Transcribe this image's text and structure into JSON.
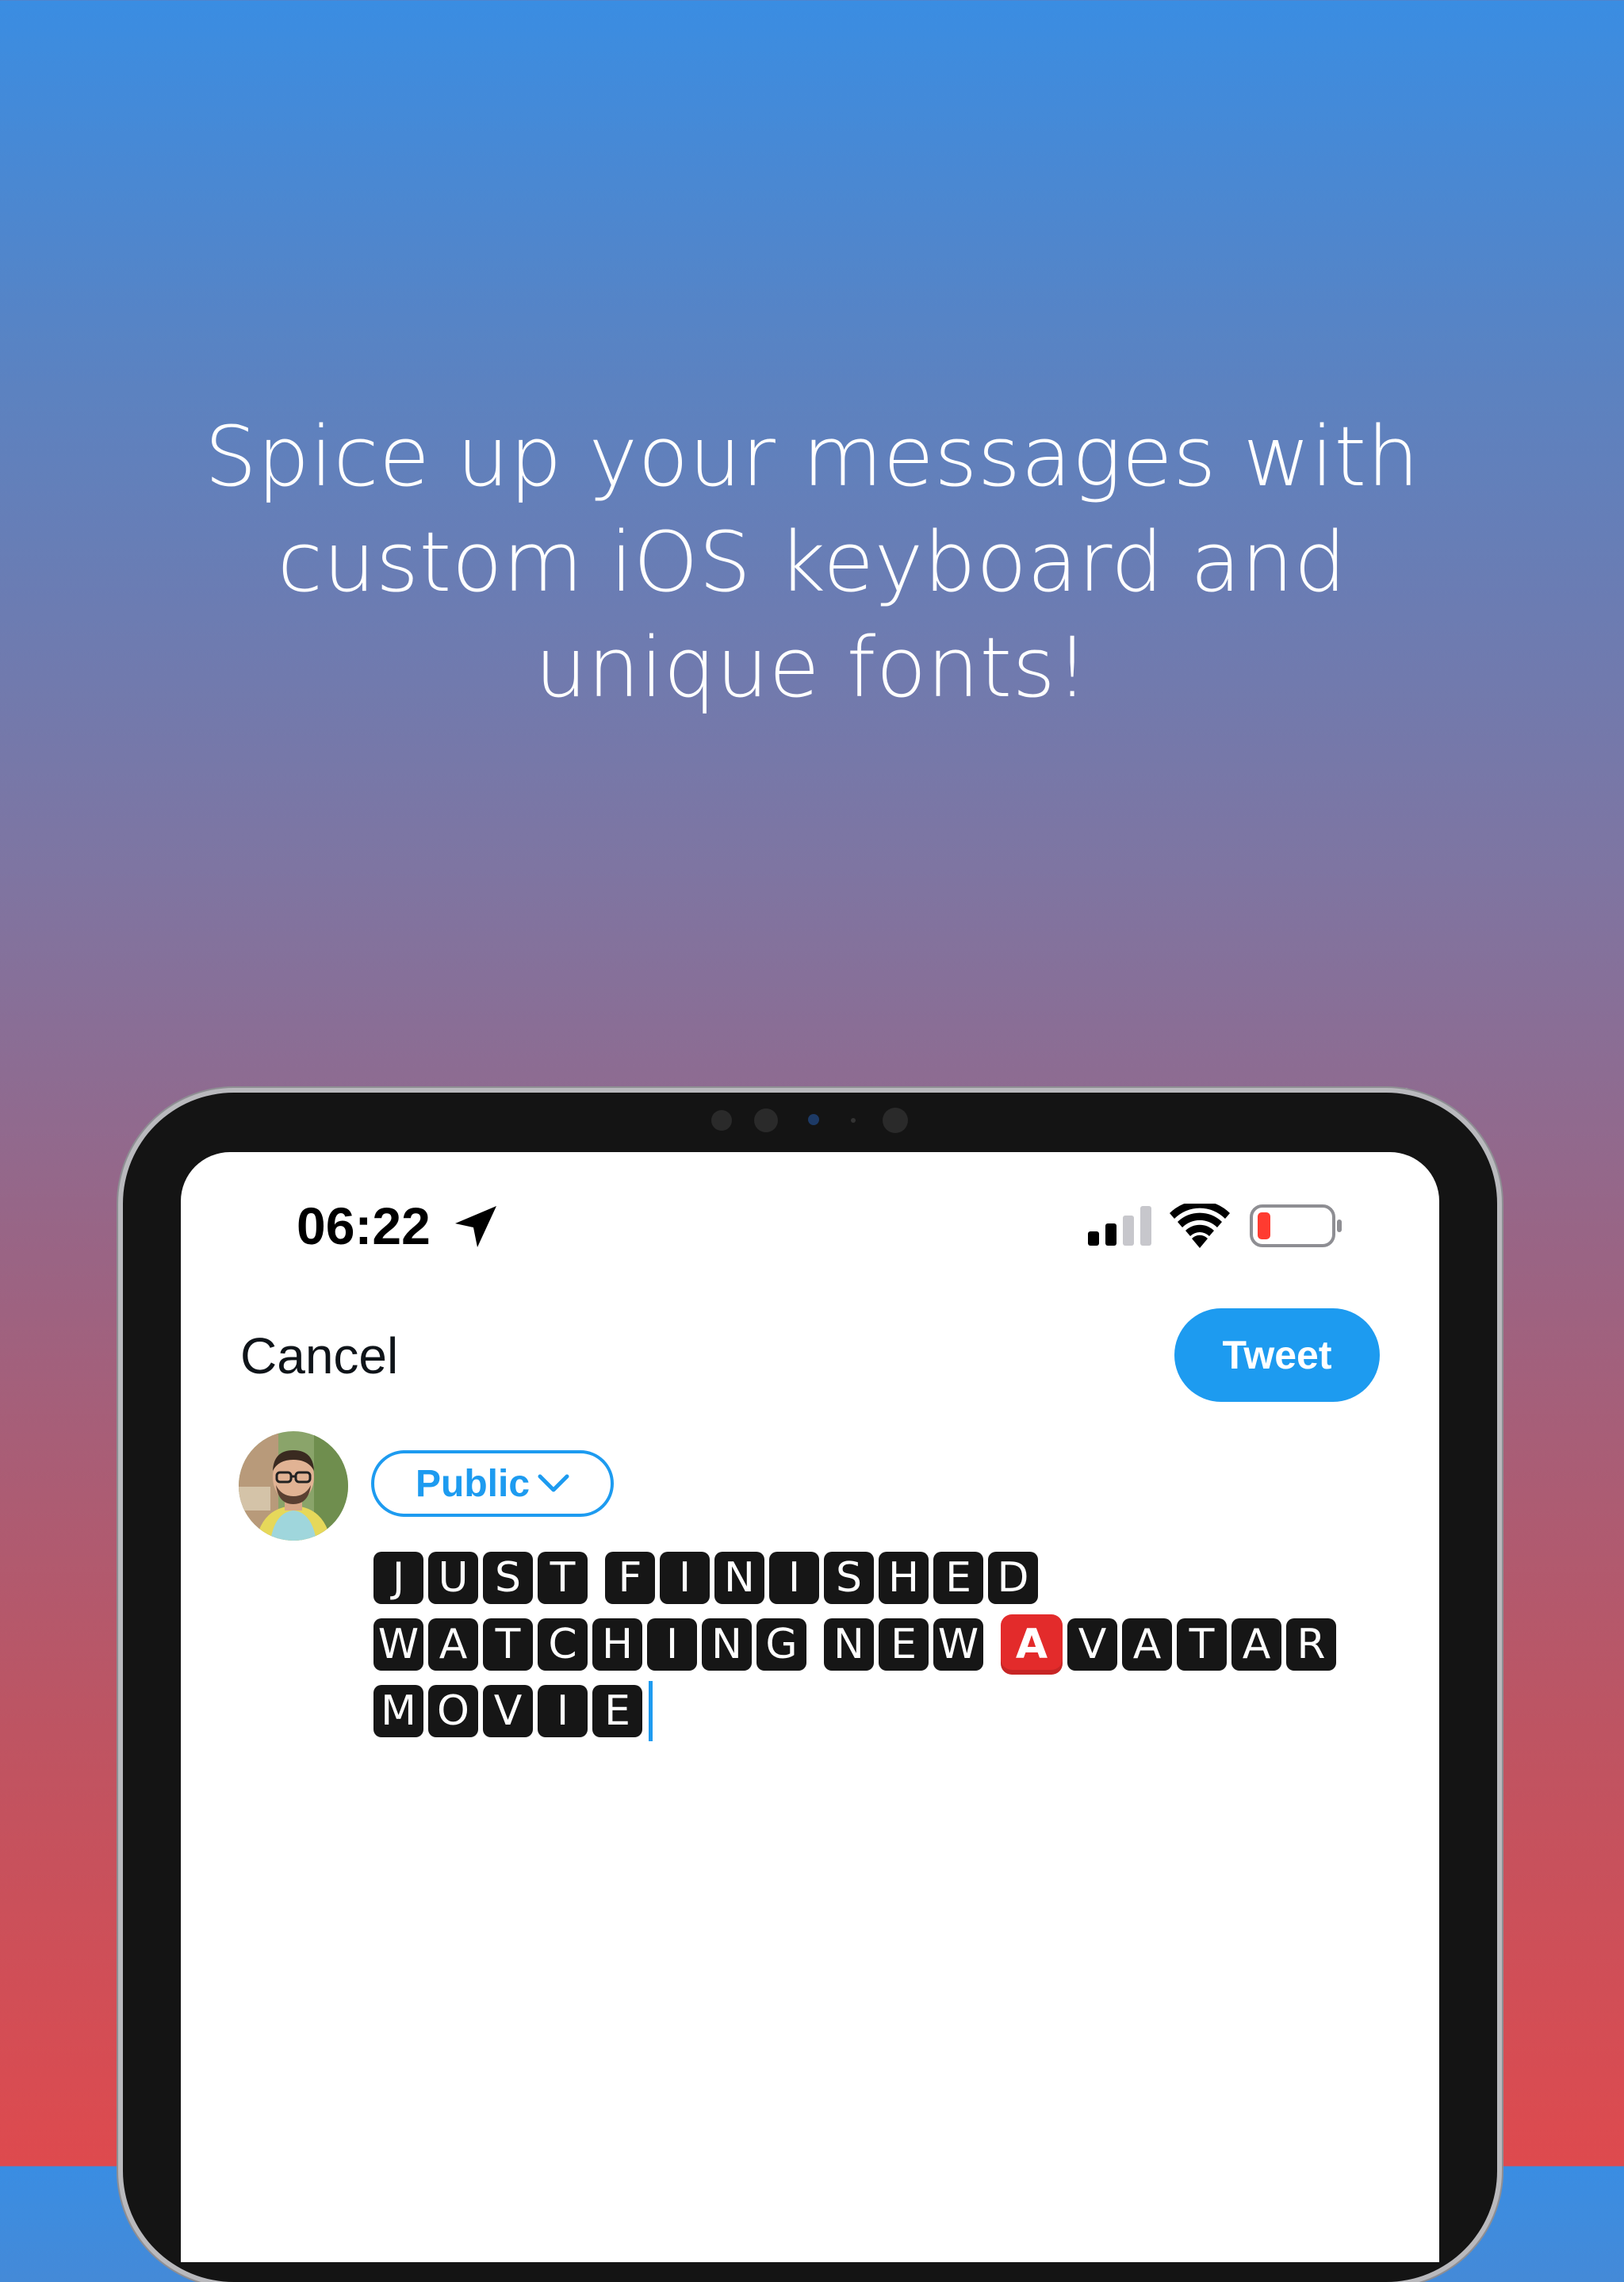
{
  "headline": {
    "line1": "Spice up your messages with",
    "line2": "custom iOS keyboard and",
    "line3": "unique fonts!"
  },
  "status_bar": {
    "time": "06:22",
    "icons": [
      "location-arrow-icon",
      "cellular-signal-icon",
      "wifi-icon",
      "battery-low-icon"
    ],
    "battery_color": "#FF3B30"
  },
  "compose": {
    "cancel_label": "Cancel",
    "tweet_label": "Tweet",
    "audience_label": "Public",
    "accent_color": "#1D9BF0",
    "text_lines": [
      [
        "J",
        "U",
        "S",
        "T",
        " ",
        "F",
        "I",
        "N",
        "I",
        "S",
        "H",
        "E",
        "D"
      ],
      [
        "W",
        "A",
        "T",
        "C",
        "H",
        "I",
        "N",
        "G",
        " ",
        "N",
        "E",
        "W",
        " ",
        "A",
        "V",
        "A",
        "T",
        "A",
        "R"
      ],
      [
        "M",
        "O",
        "V",
        "I",
        "E"
      ]
    ]
  }
}
